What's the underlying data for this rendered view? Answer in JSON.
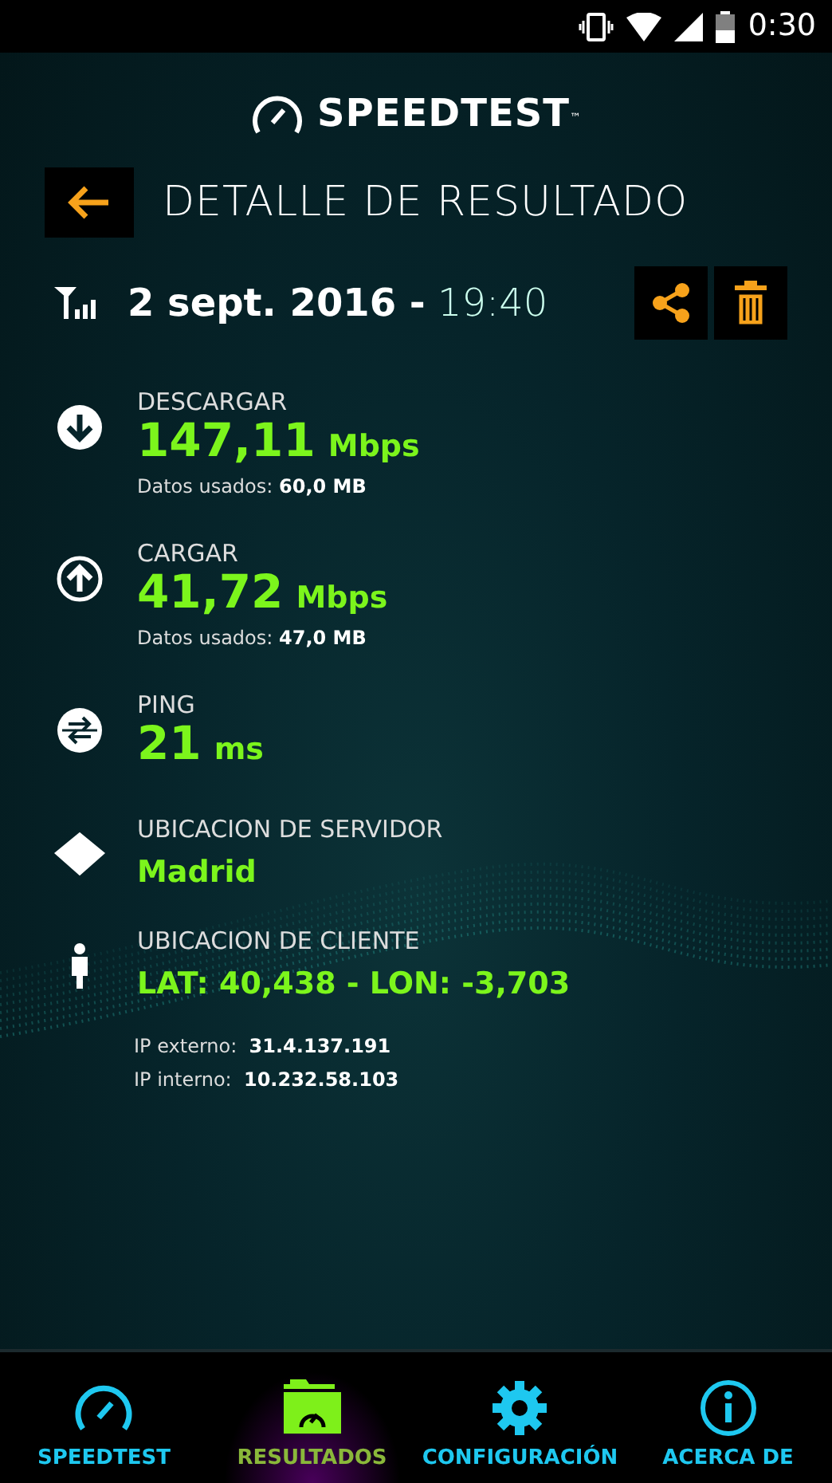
{
  "status_bar": {
    "time": "0:30"
  },
  "logo": {
    "text": "SPEEDTEST",
    "trademark": "™"
  },
  "header": {
    "title": "DETALLE DE RESULTADO"
  },
  "result": {
    "datetime": "**2 sept. 2016 -** 19:40"
  },
  "metrics": [
    {
      "kind": "download",
      "label": "DESCARGAR",
      "value": "147,11",
      "unit": "Mbps",
      "data_used": "Datos usados: **60,0 MB**"
    },
    {
      "kind": "upload",
      "label": "CARGAR",
      "value": "41,72",
      "unit": "Mbps",
      "data_used": "Datos usados: **47,0 MB**"
    },
    {
      "kind": "ping",
      "label": "PING",
      "value": "21",
      "unit": "ms"
    }
  ],
  "server": {
    "label": "UBICACION DE SERVIDOR",
    "value": "Madrid"
  },
  "client": {
    "label": "UBICACION DE CLIENTE",
    "value": "LAT: 40,438 - LON: -3,703",
    "ips": [
      "IP externo:  **31.4.137.191**",
      "IP interno:  **10.232.58.103**"
    ]
  },
  "nav": [
    {
      "kind": "speedtest",
      "label": "SPEEDTEST",
      "selected": false
    },
    {
      "kind": "results",
      "label": "RESULTADOS",
      "selected": true
    },
    {
      "kind": "settings",
      "label": "CONFIGURACIÓN",
      "selected": false
    },
    {
      "kind": "about",
      "label": "ACERCA DE",
      "selected": false
    }
  ]
}
